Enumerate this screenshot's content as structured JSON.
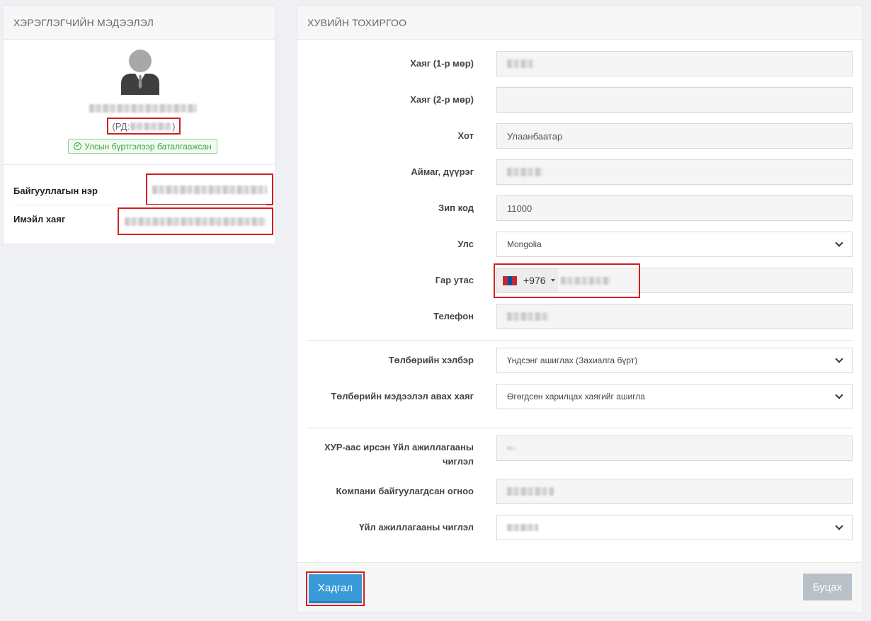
{
  "user_panel": {
    "title": "ХЭРЭГЛЭГЧИЙН МЭДЭЭЛЭЛ",
    "rd_prefix": "(РД:",
    "rd_suffix": ")",
    "verified_badge": "Улсын бүртгэлээр баталгаажсан",
    "org_name_label": "Байгууллагын нэр",
    "email_label": "Имэйл хаяг"
  },
  "settings_panel": {
    "title": "ХУВИЙН ТОХИРГОО",
    "fields": {
      "address1": {
        "label": "Хаяг (1-р мөр)"
      },
      "address2": {
        "label": "Хаяг (2-р мөр)"
      },
      "city": {
        "label": "Хот",
        "value": "Улаанбаатар"
      },
      "district": {
        "label": "Аймаг, дүүрэг"
      },
      "zip": {
        "label": "Зип код",
        "value": "11000"
      },
      "country": {
        "label": "Улс",
        "value": "Mongolia"
      },
      "mobile": {
        "label": "Гар утас",
        "dial_code": "+976"
      },
      "phone": {
        "label": "Телефон"
      },
      "payment_method": {
        "label": "Төлбөрийн хэлбэр",
        "value": "Үндсэнг ашиглах (Захиалга бүрт)"
      },
      "billing_address": {
        "label": "Төлбөрийн мэдээлэл авах хаяг",
        "value": "Өгөгдсөн харилцах хаягийг ашигла"
      },
      "activity_from_registry": {
        "label": "ХУР-аас ирсэн Үйл ажиллагааны чиглэл"
      },
      "founded_date": {
        "label": "Компани байгуулагдсан огноо"
      },
      "activity": {
        "label": "Үйл ажиллагааны чиглэл"
      }
    },
    "save_label": "Хадгал",
    "back_label": "Буцах"
  },
  "colors": {
    "accent": "#3a9ad9",
    "highlight": "#d21f1f",
    "verified": "#3ea03e"
  }
}
